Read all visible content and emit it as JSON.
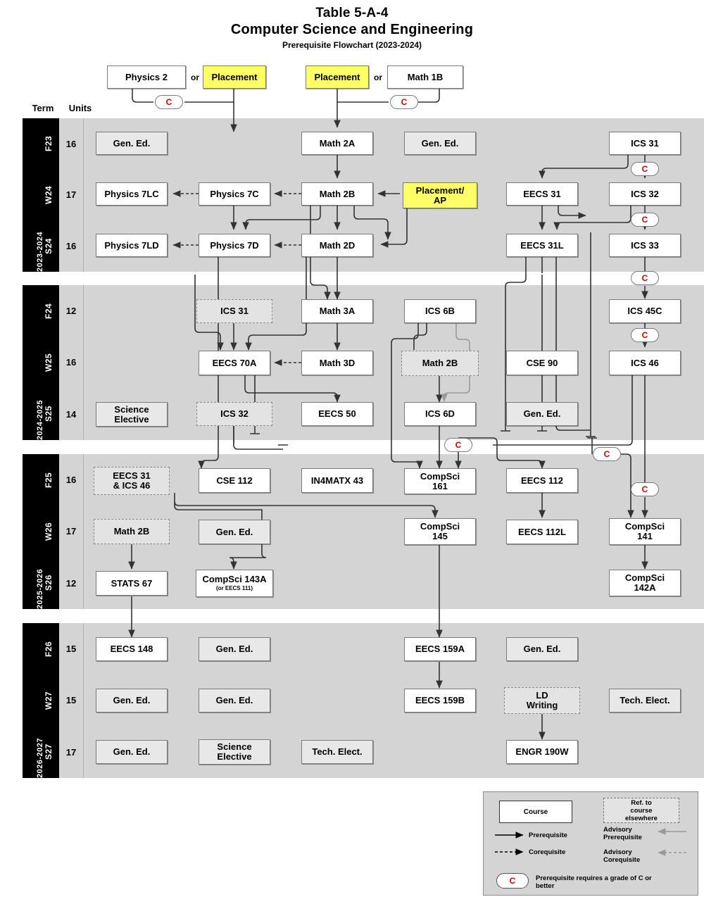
{
  "title": {
    "line1": "Table 5-A-4",
    "line2": "Computer Science and Engineering",
    "line3": "Prerequisite Flowchart (2023-2024)"
  },
  "headers": {
    "term": "Term",
    "units": "Units"
  },
  "top_row": {
    "physics2": "Physics 2",
    "or1": "or",
    "placement1": "Placement",
    "placement2": "Placement",
    "or2": "or",
    "math1b": "Math 1B"
  },
  "years": [
    {
      "label": "2023-2024",
      "terms": [
        {
          "term": "F23",
          "units": "16"
        },
        {
          "term": "W24",
          "units": "17"
        },
        {
          "term": "S24",
          "units": "16"
        }
      ]
    },
    {
      "label": "2024-2025",
      "terms": [
        {
          "term": "F24",
          "units": "12"
        },
        {
          "term": "W25",
          "units": "16"
        },
        {
          "term": "S25",
          "units": "14"
        }
      ]
    },
    {
      "label": "2025-2026",
      "terms": [
        {
          "term": "F25",
          "units": "16"
        },
        {
          "term": "W26",
          "units": "17"
        },
        {
          "term": "S26",
          "units": "12"
        }
      ]
    },
    {
      "label": "2026-2027",
      "terms": [
        {
          "term": "F26",
          "units": "15"
        },
        {
          "term": "W27",
          "units": "15"
        },
        {
          "term": "S27",
          "units": "17"
        }
      ]
    }
  ],
  "courses": {
    "n_ge_f23_a": "Gen. Ed.",
    "n_math2a": "Math 2A",
    "n_ge_f23_b": "Gen. Ed.",
    "n_ics31_f23": "ICS 31",
    "n_phys7lc": "Physics 7LC",
    "n_phys7c": "Physics 7C",
    "n_math2b_w24": "Math 2B",
    "n_placement_ap_l1": "Placement/",
    "n_placement_ap_l2": "AP",
    "n_eecs31": "EECS 31",
    "n_ics32_w24": "ICS 32",
    "n_phys7ld": "Physics 7LD",
    "n_phys7d": "Physics 7D",
    "n_math2d": "Math 2D",
    "n_eecs31l": "EECS 31L",
    "n_ics33": "ICS 33",
    "n_ics31_ref": "ICS 31",
    "n_math3a": "Math 3A",
    "n_ics6b": "ICS 6B",
    "n_ics45c": "ICS 45C",
    "n_eecs70a": "EECS 70A",
    "n_math3d": "Math 3D",
    "n_math2b_ref": "Math 2B",
    "n_cse90": "CSE 90",
    "n_ics46": "ICS 46",
    "n_scielec_s25_l1": "Science",
    "n_scielec_s25_l2": "Elective",
    "n_ics32_ref": "ICS 32",
    "n_eecs50": "EECS 50",
    "n_ics6d": "ICS 6D",
    "n_ge_s25": "Gen. Ed.",
    "n_eecs31_ics46_l1": "EECS 31",
    "n_eecs31_ics46_l2": "& ICS 46",
    "n_cse112": "CSE 112",
    "n_in4matx43": "IN4MATX 43",
    "n_compsci161_l1": "CompSci",
    "n_compsci161_l2": "161",
    "n_eecs112": "EECS 112",
    "n_math2b_ref2": "Math 2B",
    "n_ge_w26": "Gen. Ed.",
    "n_compsci145_l1": "CompSci",
    "n_compsci145_l2": "145",
    "n_eecs112l": "EECS 112L",
    "n_compsci141_l1": "CompSci",
    "n_compsci141_l2": "141",
    "n_stats67": "STATS 67",
    "n_compsci143a": "CompSci 143A",
    "n_compsci143a_sub": "(or EECS 111)",
    "n_compsci142a_l1": "CompSci",
    "n_compsci142a_l2": "142A",
    "n_eecs148": "EECS 148",
    "n_ge_f26_a": "Gen. Ed.",
    "n_eecs159a": "EECS 159A",
    "n_ge_f26_b": "Gen. Ed.",
    "n_ge_w27_a": "Gen. Ed.",
    "n_ge_w27_b": "Gen. Ed.",
    "n_eecs159b": "EECS 159B",
    "n_ldwriting_l1": "LD",
    "n_ldwriting_l2": "Writing",
    "n_techelect_w27": "Tech. Elect.",
    "n_ge_s27": "Gen. Ed.",
    "n_scielec_s27_l1": "Science",
    "n_scielec_s27_l2": "Elective",
    "n_techelect_s27": "Tech. Elect.",
    "n_engr190w": "ENGR 190W"
  },
  "grade_badge": "C",
  "legend": {
    "course": "Course",
    "ref_l1": "Ref. to",
    "ref_l2": "course",
    "ref_l3": "elsewhere",
    "prerequisite": "Prerequisite",
    "corequisite": "Corequisite",
    "advisory_prereq_l1": "Advisory",
    "advisory_prereq_l2": "Prerequisite",
    "advisory_coreq_l1": "Advisory",
    "advisory_coreq_l2": "Corequisite",
    "grade_note_l1": "Prerequisite requires a grade of C or",
    "grade_note_l2": "better",
    "grade_badge": "C"
  },
  "colors": {
    "band": "#d4d4d4",
    "highlight": "#ffff66",
    "gened": "#e8e8e8",
    "reference": "#e3e3e3",
    "badge_text": "#d00000",
    "edge": "#333333",
    "advisory_edge": "#9a9a9a"
  }
}
